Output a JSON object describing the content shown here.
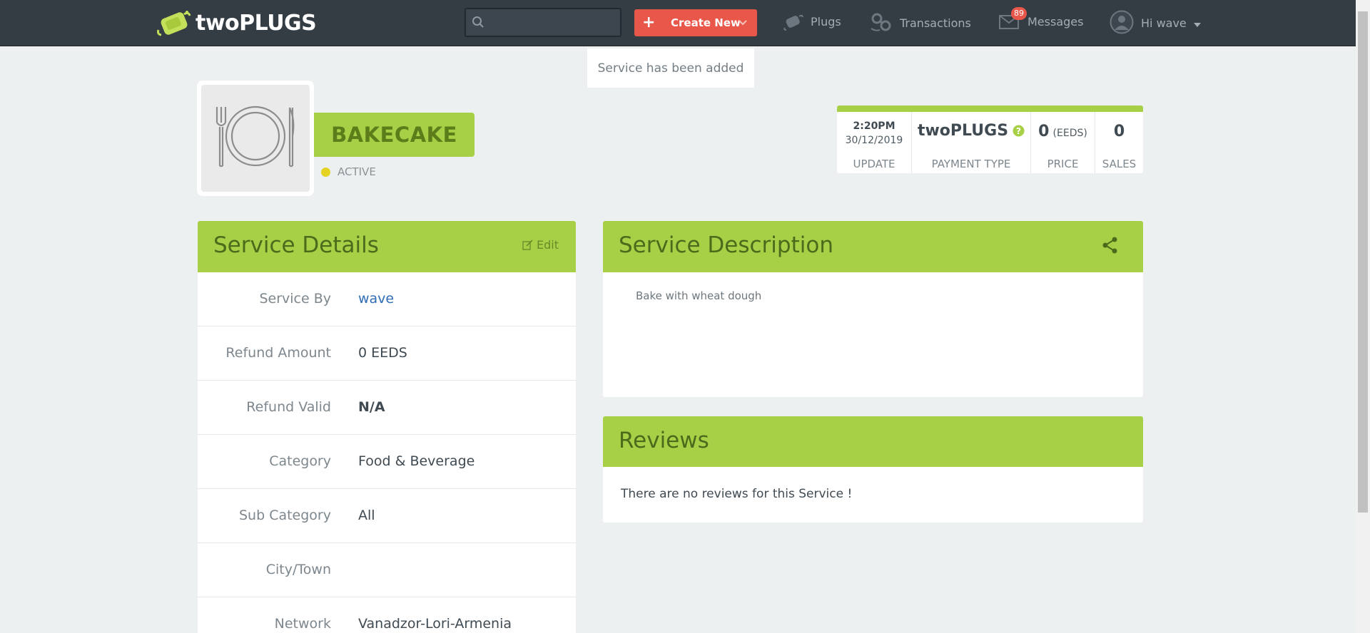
{
  "header": {
    "brand": "twoPLUGS",
    "search": {
      "placeholder": "",
      "value": ""
    },
    "create_new": "Create New",
    "nav": {
      "plugs": "Plugs",
      "transactions": "Transactions",
      "messages": "Messages",
      "user": "Hi wave"
    },
    "messages_badge": "89"
  },
  "toast": {
    "message": "Service has been added"
  },
  "service": {
    "title": "BAKECAKE",
    "status": "ACTIVE",
    "image_icon": "plate-cutlery-icon"
  },
  "stats": {
    "update": {
      "time": "2:20PM",
      "date": "30/12/2019",
      "label": "UPDATE"
    },
    "payment_type": {
      "value": "twoPLUGS",
      "label": "PAYMENT TYPE"
    },
    "price": {
      "value": "0",
      "unit": "(EEDS)",
      "label": "PRICE"
    },
    "sales": {
      "value": "0",
      "label": "SALES"
    }
  },
  "details": {
    "title": "Service Details",
    "edit": "Edit",
    "rows": [
      {
        "key": "Service By",
        "value": "wave"
      },
      {
        "key": "Refund Amount",
        "value": "0 EEDS"
      },
      {
        "key": "Refund Valid",
        "value": "N/A"
      },
      {
        "key": "Category",
        "value": "Food & Beverage"
      },
      {
        "key": "Sub Category",
        "value": "All"
      },
      {
        "key": "City/Town",
        "value": ""
      },
      {
        "key": "Network",
        "value": "Vanadzor-Lori-Armenia"
      }
    ]
  },
  "description": {
    "title": "Service Description",
    "text": "Bake with wheat dough"
  },
  "reviews": {
    "title": "Reviews",
    "empty": "There are no reviews for this Service !"
  },
  "colors": {
    "accent": "#a8d047",
    "topbar": "#343c44",
    "create": "#e9574a",
    "status_dot": "#e5d323"
  }
}
